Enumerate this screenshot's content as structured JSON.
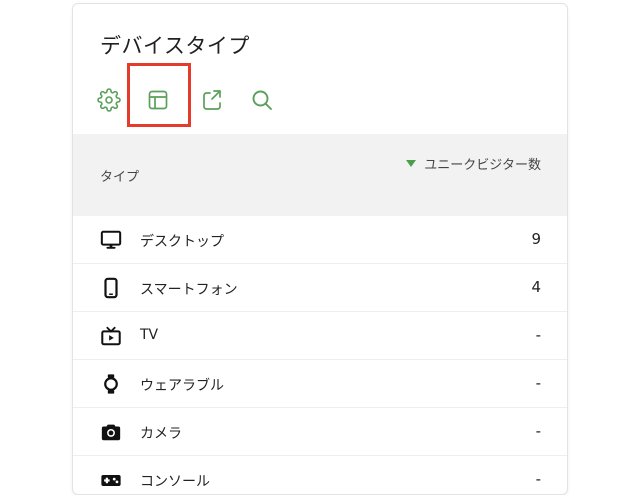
{
  "widget": {
    "title": "デバイスタイプ",
    "toolbar": [
      {
        "icon": "gear-icon"
      },
      {
        "icon": "table-icon"
      },
      {
        "icon": "export-icon"
      },
      {
        "icon": "search-icon"
      }
    ],
    "accent_color": "#5aa05a",
    "highlight_color": "#e53b2a"
  },
  "table": {
    "col_type": "タイプ",
    "col_metric": "ユニークビジター数",
    "rows": [
      {
        "icon": "desktop-icon",
        "label": "デスクトップ",
        "value": "9"
      },
      {
        "icon": "smartphone-icon",
        "label": "スマートフォン",
        "value": "4"
      },
      {
        "icon": "tv-icon",
        "label": "TV",
        "value": "-"
      },
      {
        "icon": "watch-icon",
        "label": "ウェアラブル",
        "value": "-"
      },
      {
        "icon": "camera-icon",
        "label": "カメラ",
        "value": "-"
      },
      {
        "icon": "gamepad-icon",
        "label": "コンソール",
        "value": "-"
      }
    ]
  }
}
